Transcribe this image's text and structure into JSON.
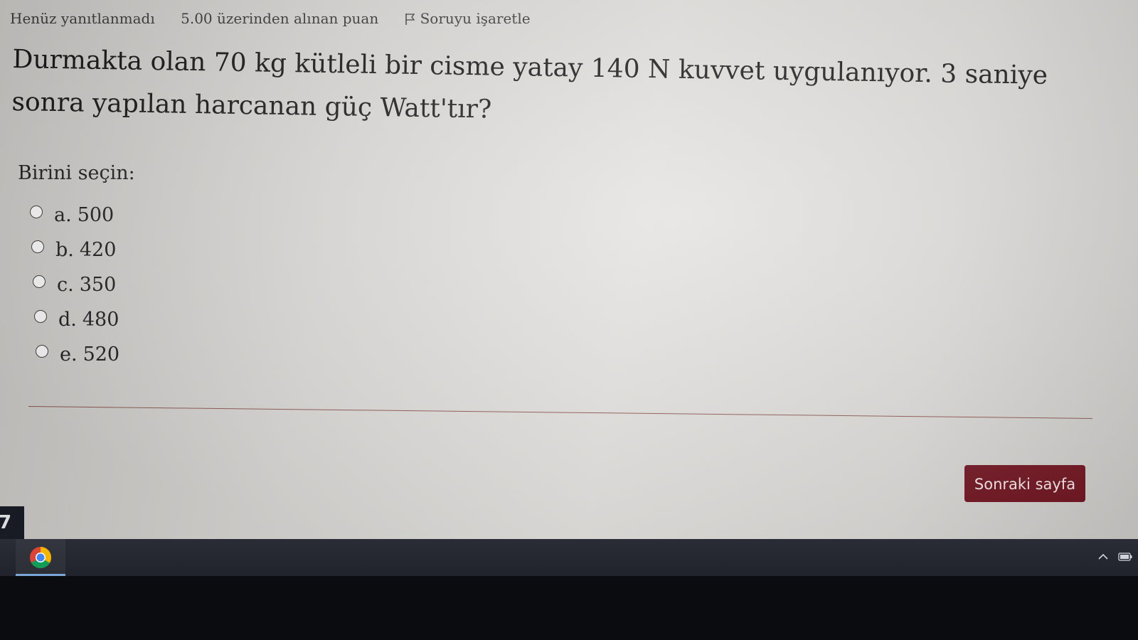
{
  "question_info": {
    "status": "Henüz yanıtlanmadı",
    "marks": "5.00 üzerinden alınan puan",
    "flag_label": "Soruyu işaretle"
  },
  "question": {
    "text": "Durmakta olan 70 kg kütleli bir cisme yatay 140 N kuvvet uygulanıyor. 3 saniye sonra yapılan harcanan güç Watt'tır?"
  },
  "answer": {
    "prompt": "Birini seçin:",
    "options": [
      {
        "letter": "a.",
        "value": "500"
      },
      {
        "letter": "b.",
        "value": "420"
      },
      {
        "letter": "c.",
        "value": "350"
      },
      {
        "letter": "d.",
        "value": "480"
      },
      {
        "letter": "e.",
        "value": "520"
      }
    ]
  },
  "navigation": {
    "next_label": "Sonraki sayfa"
  },
  "colors": {
    "accent": "#701521",
    "taskbar": "#22252d"
  },
  "icons": {
    "flag": "flag-icon",
    "taskbar_app": "chrome-icon",
    "tray": [
      "chevron-up-icon",
      "battery-icon"
    ]
  },
  "corner_tile_text": "7"
}
